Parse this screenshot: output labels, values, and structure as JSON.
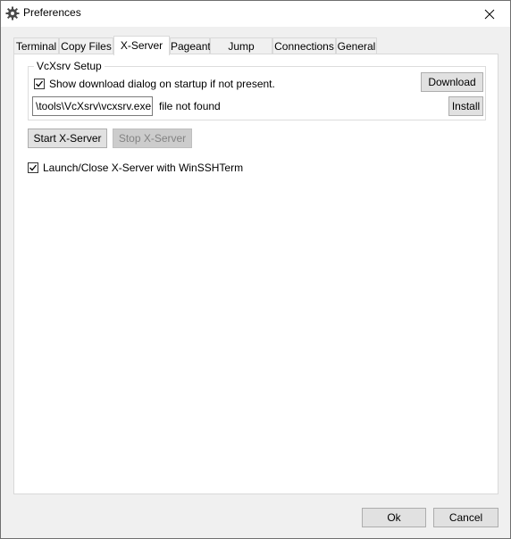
{
  "window": {
    "title": "Preferences"
  },
  "tabs": [
    {
      "label": "Terminal"
    },
    {
      "label": "Copy Files"
    },
    {
      "label": "X-Server"
    },
    {
      "label": "Pageant"
    },
    {
      "label": "Jump Server"
    },
    {
      "label": "Connections"
    },
    {
      "label": "General"
    }
  ],
  "active_tab": "X-Server",
  "vcxsrv": {
    "group_label": "VcXsrv Setup",
    "show_dialog_label": "Show download dialog on startup if not present.",
    "show_dialog_checked": true,
    "download_label": "Download",
    "path_value": "\\tools\\VcXsrv\\vcxsrv.exe",
    "status_text": "file not found",
    "install_label": "Install"
  },
  "server": {
    "start_label": "Start X-Server",
    "stop_label": "Stop X-Server",
    "launch_label": "Launch/Close X-Server with WinSSHTerm",
    "launch_checked": true
  },
  "footer": {
    "ok_label": "Ok",
    "cancel_label": "Cancel"
  }
}
